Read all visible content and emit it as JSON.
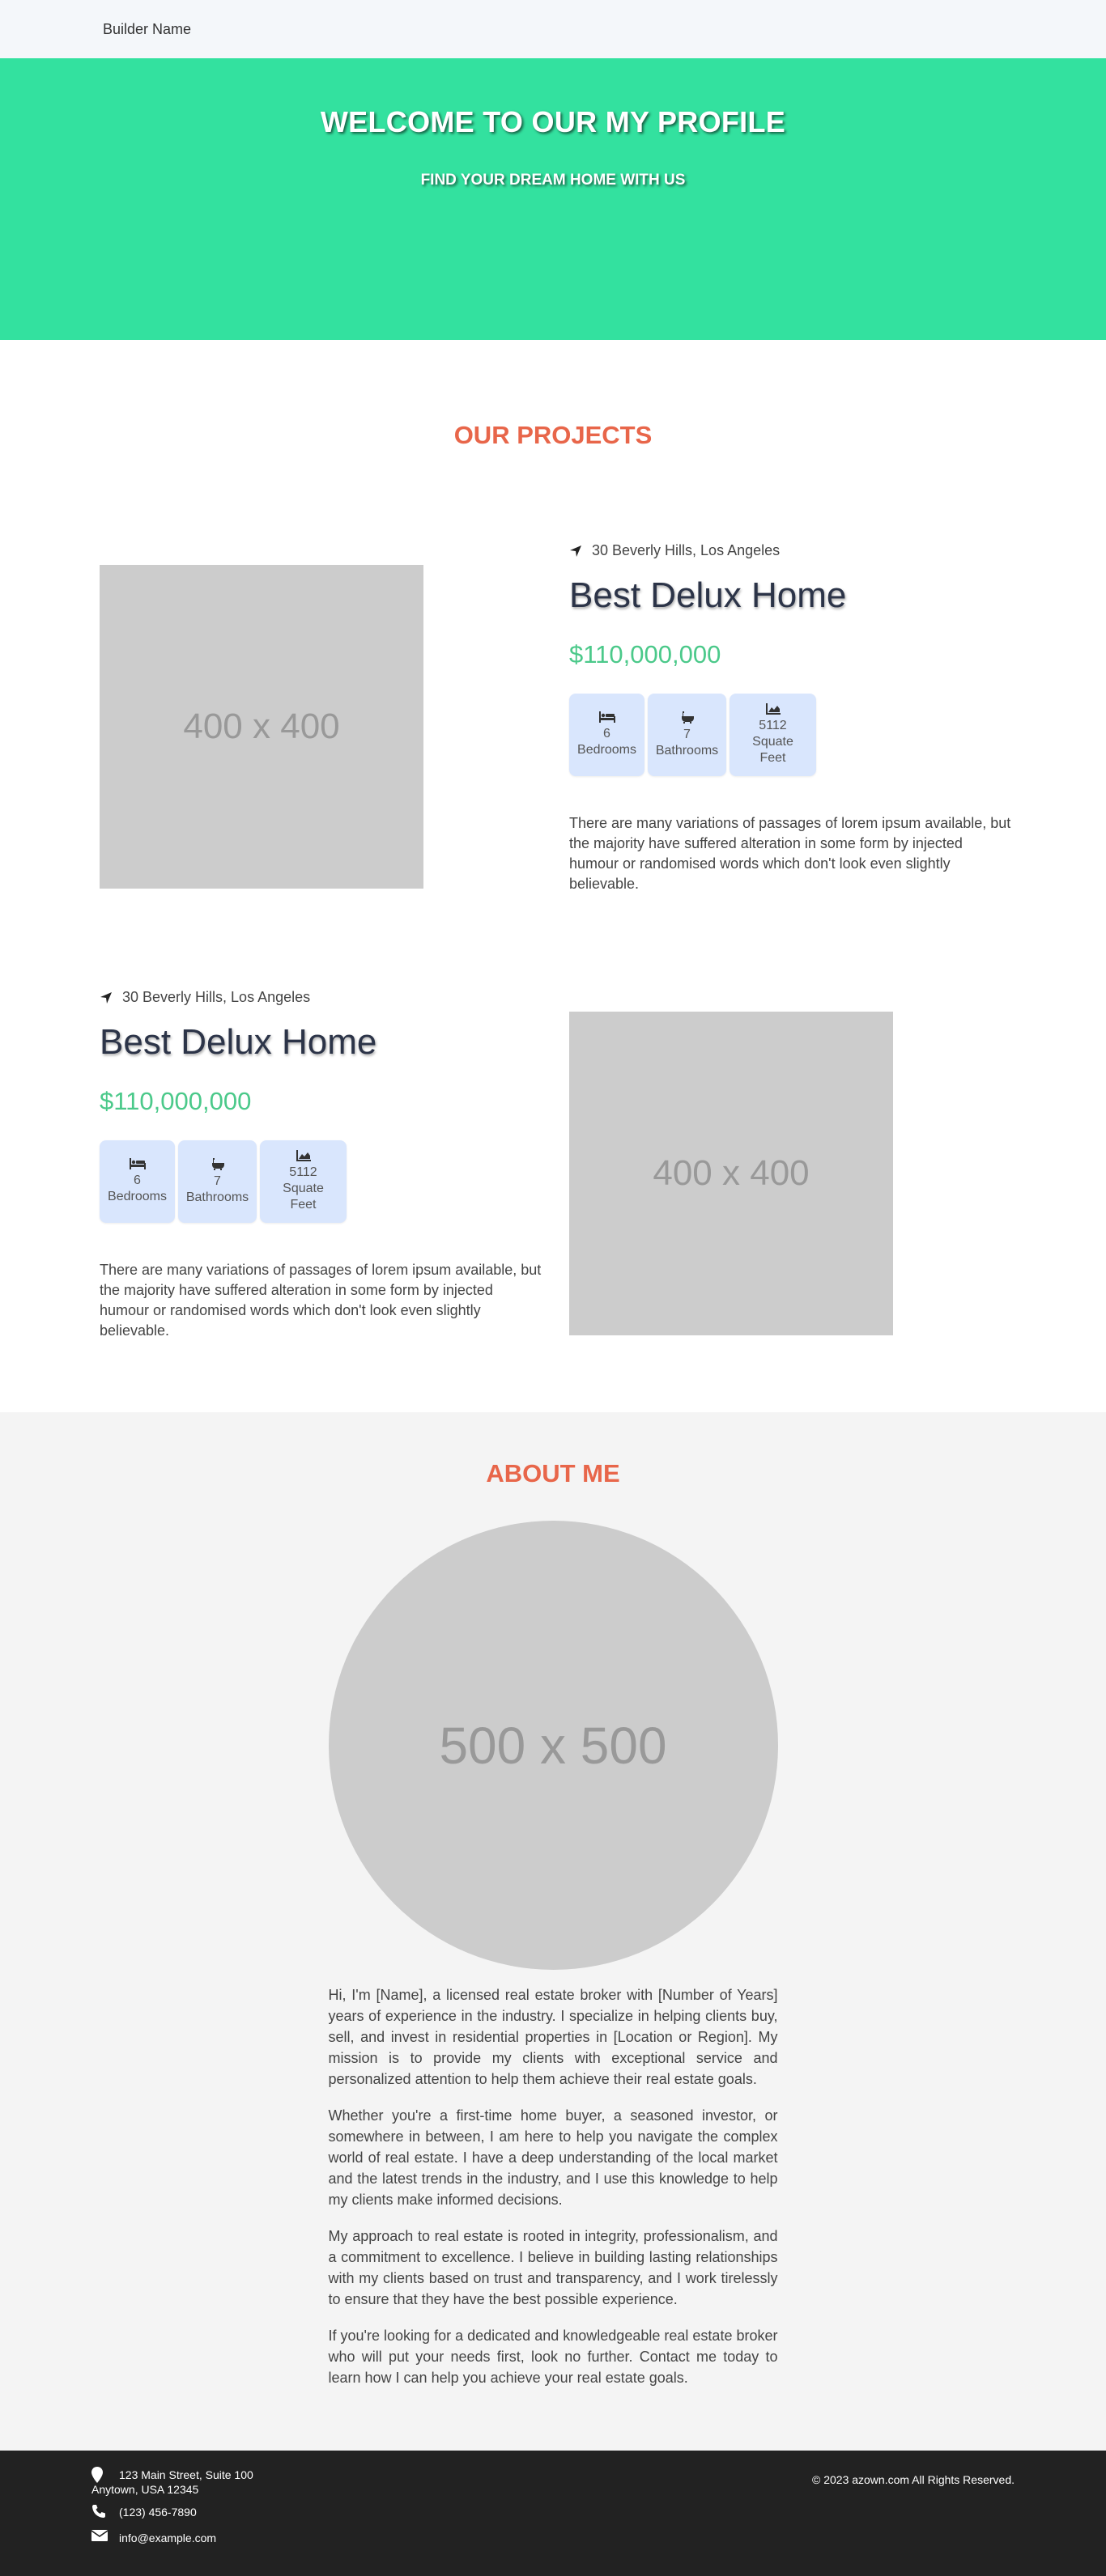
{
  "nav": {
    "brand": "Builder Name"
  },
  "hero": {
    "title": "WELCOME TO OUR MY PROFILE",
    "subtitle": "FIND YOUR DREAM HOME WITH US",
    "background_color": "#33e19f"
  },
  "projects": {
    "title": "OUR PROJECTS",
    "items": [
      {
        "image_label": "400 x 400",
        "location": "30 Beverly Hills, Los Angeles",
        "name": "Best Delux Home",
        "price": "$110,000,000",
        "features": [
          {
            "icon": "bed-icon",
            "value": "6",
            "label": "Bedrooms"
          },
          {
            "icon": "bath-icon",
            "value": "7",
            "label": "Bathrooms"
          },
          {
            "icon": "area-chart-icon",
            "value": "5112",
            "label": "Squate Feet"
          }
        ],
        "description": "There are many variations of passages of lorem ipsum available, but the majority have suffered alteration in some form by injected humour or randomised words which don't look even slightly believable."
      },
      {
        "image_label": "400 x 400",
        "location": "30 Beverly Hills, Los Angeles",
        "name": "Best Delux Home",
        "price": "$110,000,000",
        "features": [
          {
            "icon": "bed-icon",
            "value": "6",
            "label": "Bedrooms"
          },
          {
            "icon": "bath-icon",
            "value": "7",
            "label": "Bathrooms"
          },
          {
            "icon": "area-chart-icon",
            "value": "5112",
            "label": "Squate Feet"
          }
        ],
        "description": "There are many variations of passages of lorem ipsum available, but the majority have suffered alteration in some form by injected humour or randomised words which don't look even slightly believable."
      }
    ]
  },
  "about": {
    "title": "ABOUT ME",
    "image_label": "500 x 500",
    "paragraphs": [
      "Hi, I'm [Name], a licensed real estate broker with [Number of Years] years of experience in the industry. I specialize in helping clients buy, sell, and invest in residential properties in [Location or Region]. My mission is to provide my clients with exceptional service and personalized attention to help them achieve their real estate goals.",
      "Whether you're a first-time home buyer, a seasoned investor, or somewhere in between, I am here to help you navigate the complex world of real estate. I have a deep understanding of the local market and the latest trends in the industry, and I use this knowledge to help my clients make informed decisions.",
      "My approach to real estate is rooted in integrity, professionalism, and a commitment to excellence. I believe in building lasting relationships with my clients based on trust and transparency, and I work tirelessly to ensure that they have the best possible experience.",
      "If you're looking for a dedicated and knowledgeable real estate broker who will put your needs first, look no further. Contact me today to learn how I can help you achieve your real estate goals."
    ]
  },
  "footer": {
    "address_line1": "123 Main Street, Suite 100",
    "address_line2": "Anytown, USA 12345",
    "phone": "(123) 456-7890",
    "email": "info@example.com",
    "copyright": "© 2023 azown.com All Rights Reserved."
  },
  "colors": {
    "accent_title": "#e8664a",
    "price": "#4bc98a",
    "feature_bg": "#d9e6fd",
    "footer_bg": "#222222"
  }
}
